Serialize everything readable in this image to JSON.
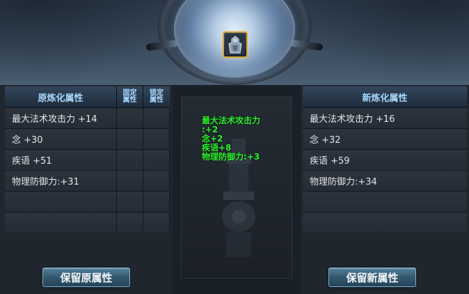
{
  "left_panel": {
    "header": {
      "title": "原炼化属性",
      "fixed_label": "固定属性",
      "lock_label": "锁定属性"
    },
    "rows": [
      {
        "text": "最大法术攻击力 +14"
      },
      {
        "text": "念 +30"
      },
      {
        "text": "疾语 +51"
      },
      {
        "text": "物理防御力:+31"
      },
      {
        "text": ""
      },
      {
        "text": ""
      }
    ],
    "keep_button": "保留原属性"
  },
  "center_panel": {
    "lines": [
      "最大法术攻击力",
      ":+2",
      "念+2",
      "疾语+8",
      "物理防御力:+3"
    ],
    "text_color": "#2cf22c"
  },
  "right_panel": {
    "header": {
      "title": "新炼化属性"
    },
    "rows": [
      {
        "text": "最大法术攻击力 +16"
      },
      {
        "text": "念 +32"
      },
      {
        "text": "疾语 +59"
      },
      {
        "text": "物理防御力:+34"
      },
      {
        "text": ""
      },
      {
        "text": ""
      }
    ],
    "keep_button": "保留新属性"
  },
  "item_slot": {
    "icon": "armor-icon",
    "border_color": "#d4a63c"
  },
  "colors": {
    "header_text": "#a8d8ff",
    "button_border": "#7fb1cc"
  }
}
